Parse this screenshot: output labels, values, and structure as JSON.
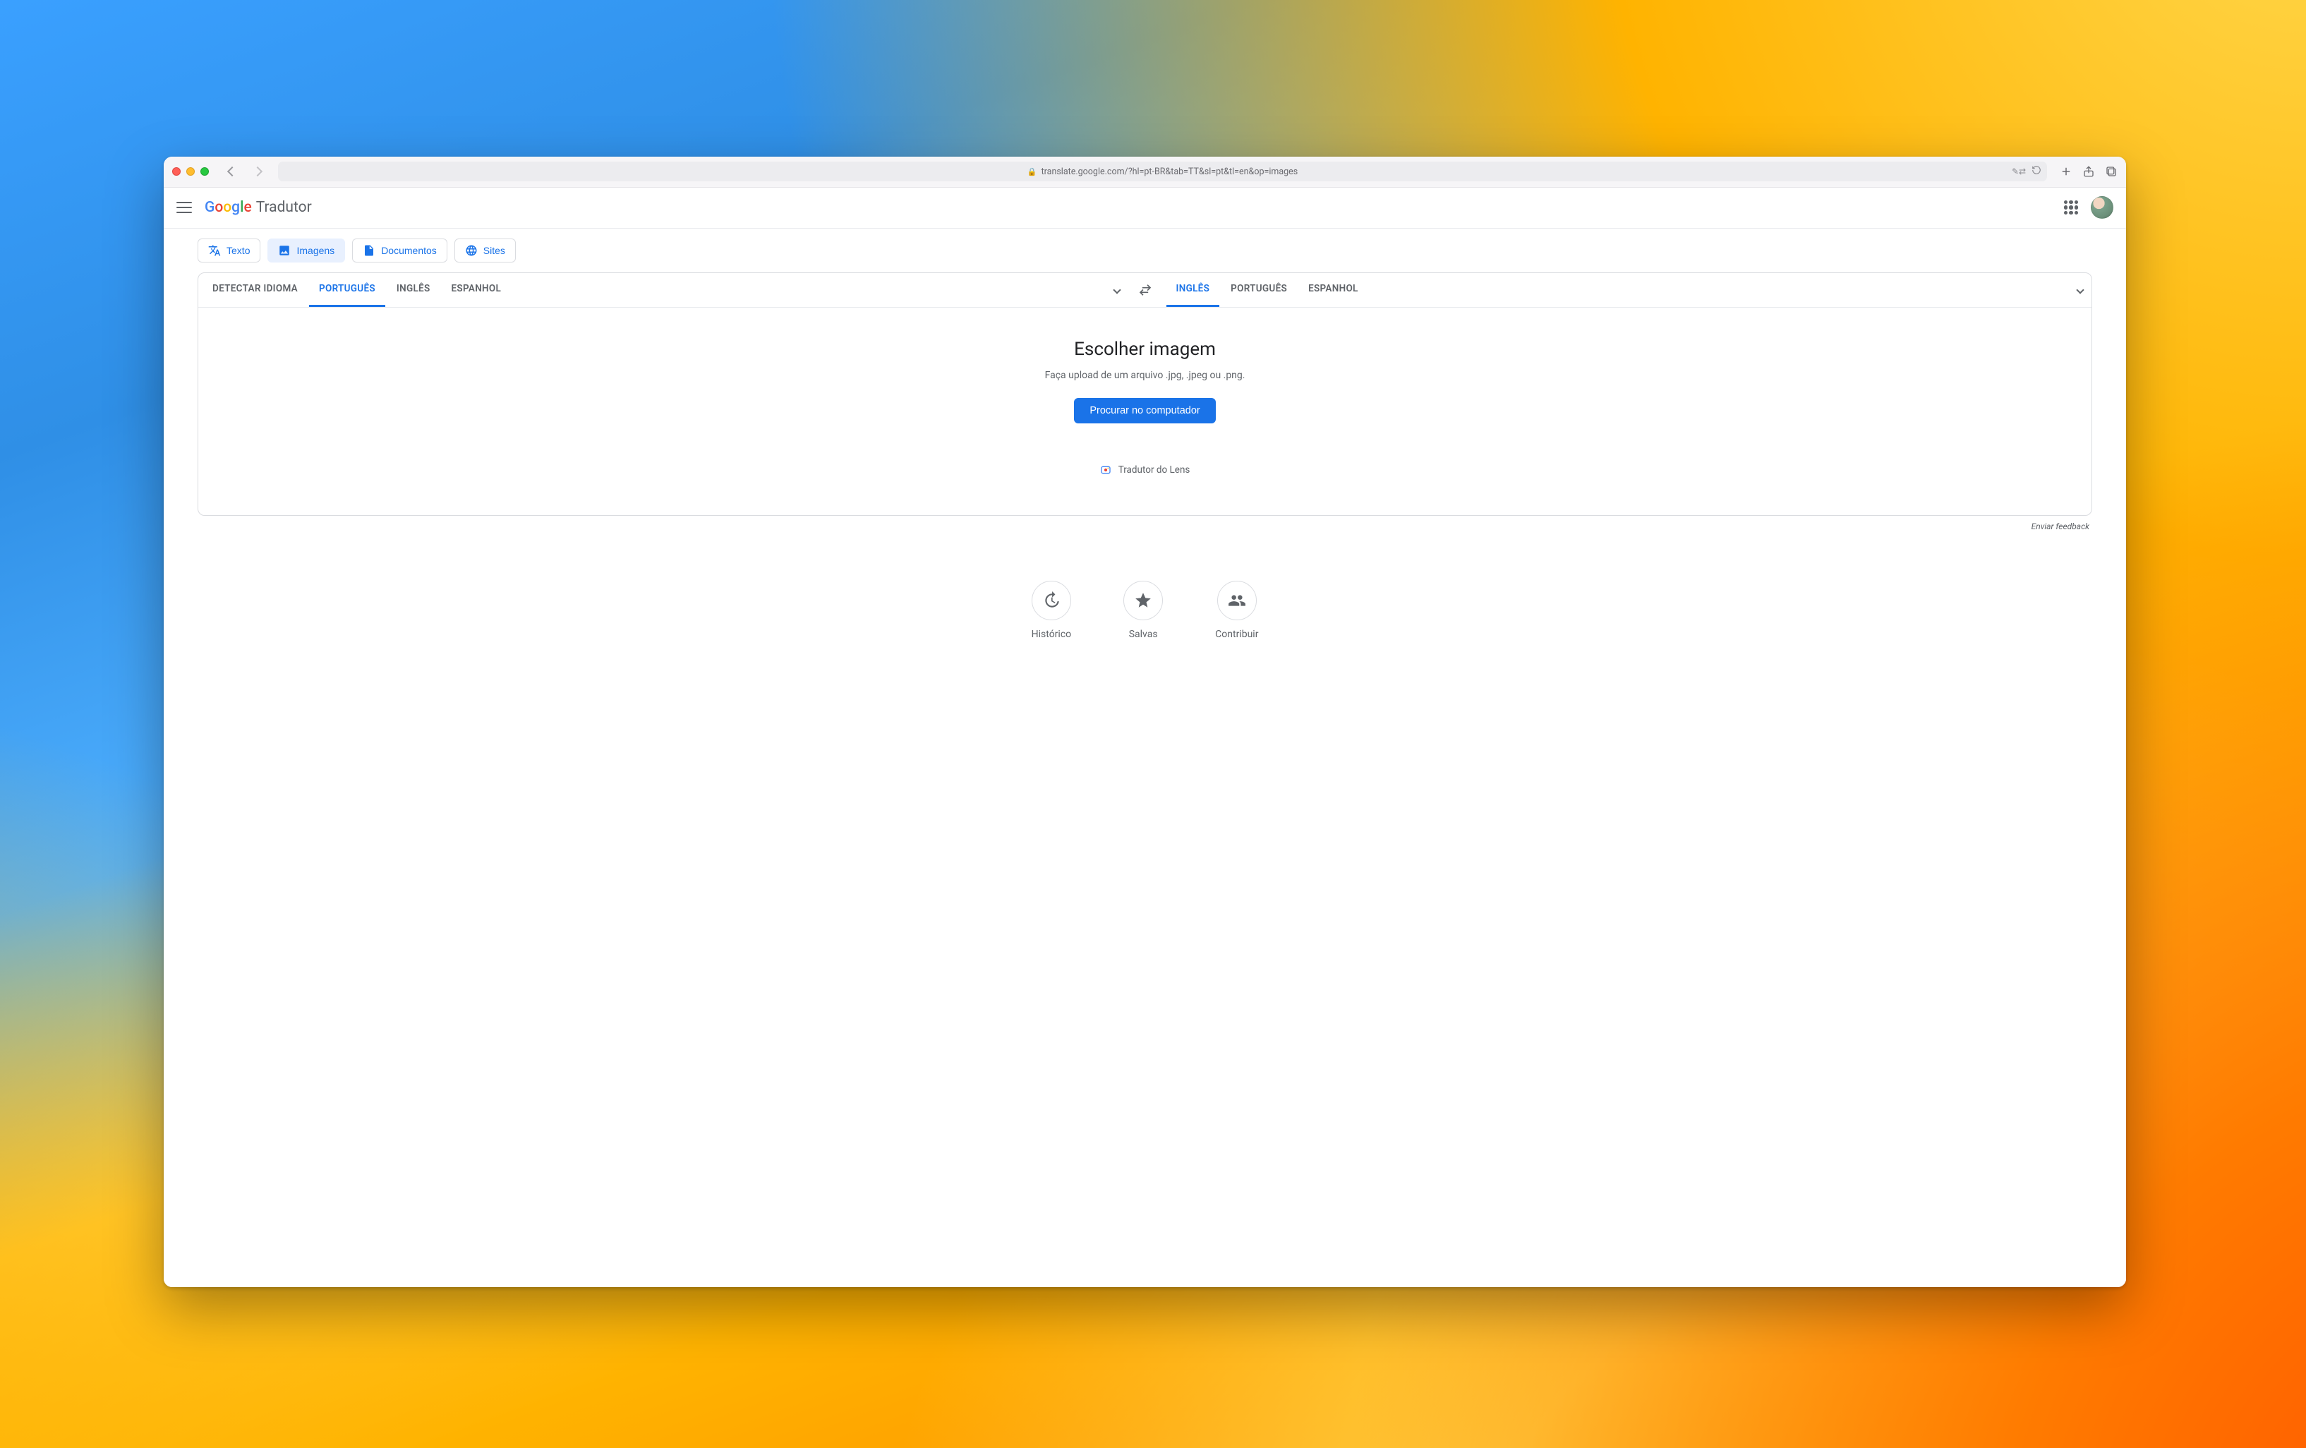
{
  "browser": {
    "url": "translate.google.com/?hl=pt-BR&tab=TT&sl=pt&tl=en&op=images"
  },
  "header": {
    "product_name": "Tradutor"
  },
  "mode_chips": {
    "text": "Texto",
    "images": "Imagens",
    "documents": "Documentos",
    "sites": "Sites"
  },
  "source_langs": {
    "detect": "DETECTAR IDIOMA",
    "l1": "PORTUGUÊS",
    "l2": "INGLÊS",
    "l3": "ESPANHOL"
  },
  "target_langs": {
    "l1": "INGLÊS",
    "l2": "PORTUGUÊS",
    "l3": "ESPANHOL"
  },
  "chooser": {
    "title": "Escolher imagem",
    "subtitle": "Faça upload de um arquivo .jpg, .jpeg ou .png.",
    "browse": "Procurar no computador",
    "lens": "Tradutor do Lens"
  },
  "feedback": "Enviar feedback",
  "bottom": {
    "history": "Histórico",
    "saved": "Salvas",
    "contribute": "Contribuir"
  }
}
